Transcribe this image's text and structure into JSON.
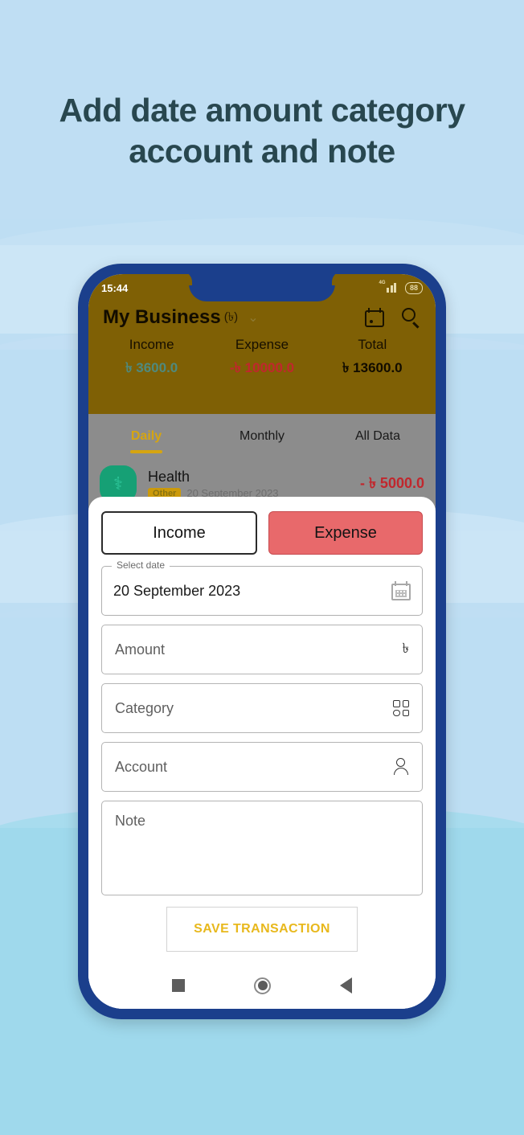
{
  "headline": "Add date amount category\naccount and note",
  "phone": {
    "status_bar": {
      "time": "15:44",
      "network": "4G",
      "battery": "88"
    },
    "app_bar": {
      "title": "My Business",
      "currency": "(৳)",
      "chevron": "⌄",
      "calendar_icon": "calendar-icon",
      "search_icon": "search-icon"
    },
    "summary": [
      {
        "label": "Income",
        "value": "৳ 3600.0",
        "color": "#4f8a7e"
      },
      {
        "label": "Expense",
        "value": "-৳ 10000.0",
        "color": "#c1272d"
      },
      {
        "label": "Total",
        "value": "৳ 13600.0",
        "color": "#120c00"
      }
    ],
    "tabs": [
      {
        "label": "Daily",
        "active": true
      },
      {
        "label": "Monthly",
        "active": false
      },
      {
        "label": "All Data",
        "active": false
      }
    ],
    "transaction": {
      "icon": "health-icon",
      "title": "Health",
      "badge": "Other",
      "date": "20 September 2023",
      "amount": "- ৳ 5000.0"
    },
    "sheet": {
      "income_label": "Income",
      "expense_label": "Expense",
      "date_field": {
        "label": "Select date",
        "value": "20 September 2023",
        "icon": "calendar-icon"
      },
      "amount_field": {
        "placeholder": "Amount",
        "icon": "taka-icon",
        "icon_glyph": "৳"
      },
      "category_field": {
        "placeholder": "Category",
        "icon": "grid-icon"
      },
      "account_field": {
        "placeholder": "Account",
        "icon": "person-icon"
      },
      "note_field": {
        "placeholder": "Note"
      },
      "save_label": "SAVE TRANSACTION"
    },
    "nav_bar": {
      "recents": "square-icon",
      "home": "circle-icon",
      "back": "triangle-back-icon"
    }
  },
  "colors": {
    "app_bar": "#7f6005",
    "phone_frame": "#1b3f8c",
    "accent_amber": "#d6a510",
    "expense_red": "#e8696b",
    "background": "#bedef3"
  }
}
